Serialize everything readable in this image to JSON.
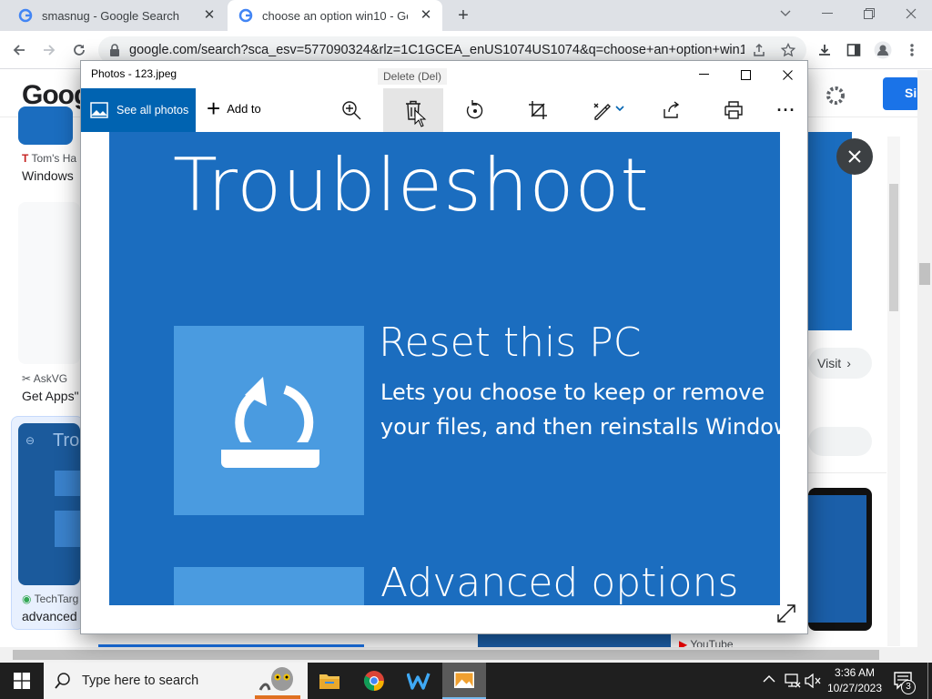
{
  "chrome": {
    "tabs": [
      {
        "title": "smasnug - Google Search",
        "active": false
      },
      {
        "title": "choose an option win10 - Goog",
        "active": true
      }
    ],
    "url": "google.com/search?sca_esv=577090324&rlz=1C1GCEA_enUS1074US1074&q=choose+an+option+win10&...",
    "new_tab_label": "+",
    "close_glyph": "✕"
  },
  "google_page": {
    "logo_partial": "Goog",
    "signin_partial": "Si",
    "results": [
      {
        "source": "Tom's Ha",
        "title": "Windows"
      },
      {
        "source": "AskVG",
        "title": "Get Apps\""
      },
      {
        "source": "TechTarg",
        "title": "advanced"
      },
      {
        "source": "YouTube",
        "title": ""
      }
    ],
    "visit_label": "Visit",
    "thumb_text": "Tro"
  },
  "photos_app": {
    "title": "Photos - 123.jpeg",
    "see_all_label": "See all photos",
    "add_to_label": "Add to",
    "tooltip": "Delete (Del)",
    "toolbar_icons": [
      "zoom-in-icon",
      "delete-icon",
      "rotate-icon",
      "crop-icon",
      "edit-draw-icon",
      "share-icon",
      "print-icon",
      "more-icon"
    ],
    "more_glyph": "···",
    "image": {
      "heading": "Troubleshoot",
      "option1_title": "Reset this PC",
      "option1_desc_line1": "Lets you choose to keep or remove",
      "option1_desc_line2": "your files, and then reinstalls Window",
      "option2_title": "Advanced options"
    }
  },
  "taskbar": {
    "search_placeholder": "Type here to search",
    "time": "3:36 AM",
    "date": "10/27/2023",
    "notification_count": "3"
  },
  "colors": {
    "photos_accent": "#0063b1",
    "troubleshoot_blue": "#1b6dbf",
    "tile_blue": "#4a9be0",
    "taskbar": "#1f1f1f"
  }
}
